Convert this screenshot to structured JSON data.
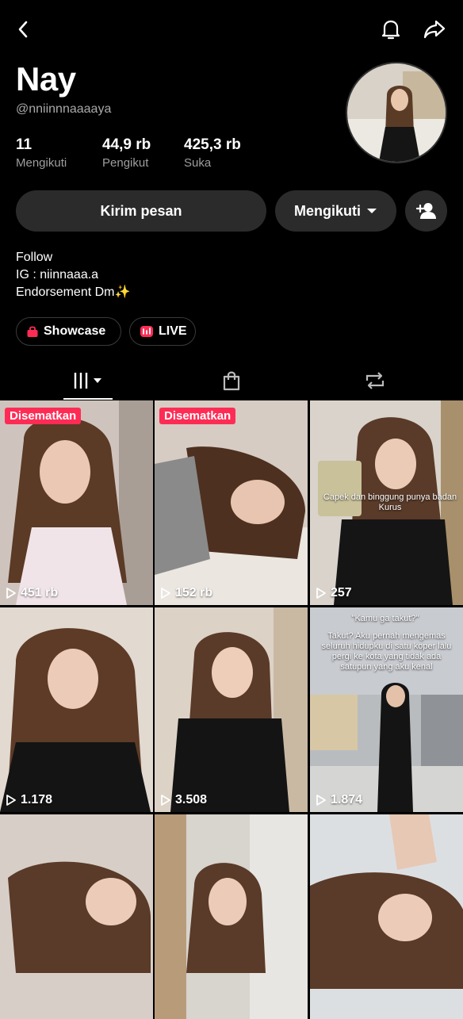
{
  "header": {
    "back_icon": "chevron-left-icon",
    "bell_icon": "bell-icon",
    "share_icon": "share-arrow-icon"
  },
  "profile": {
    "name": "Nay",
    "handle": "@nniinnnaaaaya",
    "stats": [
      {
        "value": "11",
        "label": "Mengikuti"
      },
      {
        "value": "44,9 rb",
        "label": "Pengikut"
      },
      {
        "value": "425,3 rb",
        "label": "Suka"
      }
    ],
    "bio": [
      "Follow",
      "IG : niinnaaa.a",
      "Endorsement Dm✨"
    ]
  },
  "actions": {
    "message": "Kirim pesan",
    "following": "Mengikuti"
  },
  "chips": {
    "showcase": "Showcase",
    "live": "LIVE"
  },
  "colors": {
    "pinned": "#fe2c55",
    "button_bg": "#2b2b2b",
    "background": "#000000"
  },
  "videos": [
    {
      "pinned": "Disematkan",
      "views": "451 rb",
      "caption": ""
    },
    {
      "pinned": "Disematkan",
      "views": "152 rb",
      "caption": ""
    },
    {
      "pinned": "",
      "views": "257",
      "caption": "Capek dan binggung punya badan Kurus"
    },
    {
      "pinned": "",
      "views": "1.178",
      "caption": ""
    },
    {
      "pinned": "",
      "views": "3.508",
      "caption": ""
    },
    {
      "pinned": "",
      "views": "1.874",
      "caption": "\"Kamu ga takut?\"",
      "caption2": "Takut? Aku pernah mengemas seluruh hidupku di satu koper lalu pergi ke kota yang tidak ada satupun yang aku kenal"
    },
    {
      "pinned": "",
      "views": "",
      "caption": ""
    },
    {
      "pinned": "",
      "views": "",
      "caption": ""
    },
    {
      "pinned": "",
      "views": "",
      "caption": ""
    }
  ]
}
